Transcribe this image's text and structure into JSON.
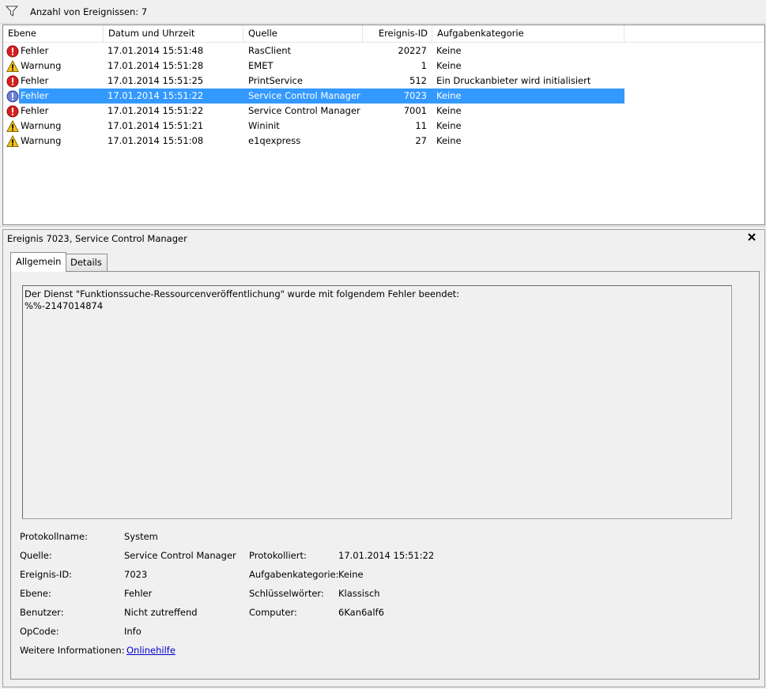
{
  "toolbar": {
    "event_count": "Anzahl von Ereignissen: 7"
  },
  "grid": {
    "columns": [
      "Ebene",
      "Datum und Uhrzeit",
      "Quelle",
      "Ereignis-ID",
      "Aufgabenkategorie"
    ],
    "rows": [
      {
        "level": "Fehler",
        "date": "17.01.2014 15:51:48",
        "source": "RasClient",
        "id": "20227",
        "category": "Keine"
      },
      {
        "level": "Warnung",
        "date": "17.01.2014 15:51:28",
        "source": "EMET",
        "id": "1",
        "category": "Keine"
      },
      {
        "level": "Fehler",
        "date": "17.01.2014 15:51:25",
        "source": "PrintService",
        "id": "512",
        "category": "Ein Druckanbieter wird initialisiert"
      },
      {
        "level": "Fehler",
        "date": "17.01.2014 15:51:22",
        "source": "Service Control Manager",
        "id": "7023",
        "category": "Keine"
      },
      {
        "level": "Fehler",
        "date": "17.01.2014 15:51:22",
        "source": "Service Control Manager",
        "id": "7001",
        "category": "Keine"
      },
      {
        "level": "Warnung",
        "date": "17.01.2014 15:51:21",
        "source": "Wininit",
        "id": "11",
        "category": "Keine"
      },
      {
        "level": "Warnung",
        "date": "17.01.2014 15:51:08",
        "source": "e1qexpress",
        "id": "27",
        "category": "Keine"
      }
    ]
  },
  "detail": {
    "title": "Ereignis 7023, Service Control Manager",
    "tabs": [
      "Allgemein",
      "Details"
    ],
    "message_line1": "Der Dienst \"Funktionssuche-Ressourcenveröffentlichung\" wurde mit folgendem Fehler beendet:",
    "message_line2": "%%-2147014874",
    "fields": {
      "log_name_label": "Protokollname:",
      "log_name": "System",
      "source_label": "Quelle:",
      "source": "Service Control Manager",
      "logged_label": "Protokolliert:",
      "logged": "17.01.2014 15:51:22",
      "event_id_label": "Ereignis-ID:",
      "event_id": "7023",
      "task_category_label": "Aufgabenkategorie:",
      "task_category": "Keine",
      "level_label": "Ebene:",
      "level": "Fehler",
      "keywords_label": "Schlüsselwörter:",
      "keywords": "Klassisch",
      "user_label": "Benutzer:",
      "user": "Nicht zutreffend",
      "computer_label": "Computer:",
      "computer": "6Kan6alf6",
      "opcode_label": "OpCode:",
      "opcode": "Info",
      "more_info_label": "Weitere Informationen:",
      "more_info_link": "Onlinehilfe"
    }
  },
  "colors": {
    "selection": "#3399ff",
    "error": "#d62020",
    "warning": "#f2c21b",
    "link": "#0000cc"
  }
}
